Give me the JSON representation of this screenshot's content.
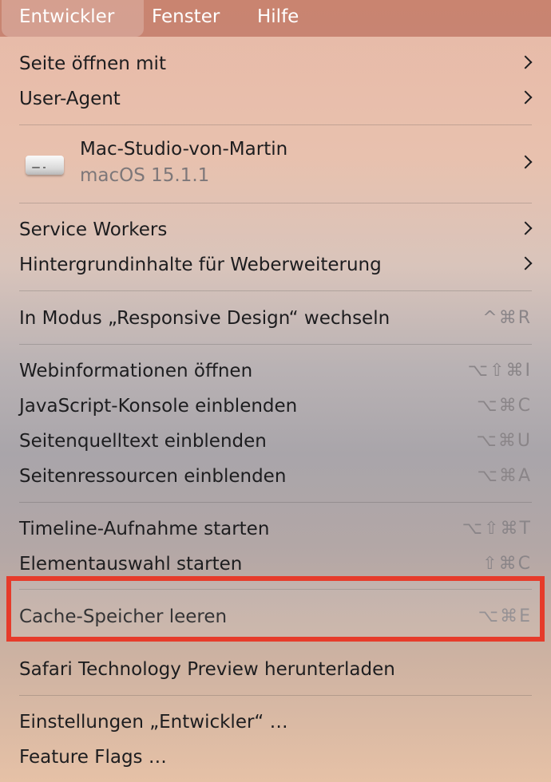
{
  "menubar": {
    "items": [
      {
        "label": "Entwickler",
        "active": true
      },
      {
        "label": "Fenster"
      },
      {
        "label": "Hilfe"
      }
    ]
  },
  "menu": {
    "open_with": "Seite öffnen mit",
    "user_agent": "User-Agent",
    "device": {
      "name": "Mac-Studio-von-Martin",
      "os": "macOS 15.1.1",
      "icon": "mac-studio-icon"
    },
    "service_workers": "Service Workers",
    "background_content": "Hintergrundinhalte für Weberweiterung",
    "responsive": {
      "label": "In Modus „Responsive Design“ wechseln",
      "shortcut": "^⌘R"
    },
    "web_inspector": {
      "label": "Webinformationen öffnen",
      "shortcut": "⌥⇧⌘I"
    },
    "js_console": {
      "label": "JavaScript-Konsole einblenden",
      "shortcut": "⌥⌘C"
    },
    "page_source": {
      "label": "Seitenquelltext einblenden",
      "shortcut": "⌥⌘U"
    },
    "page_resources": {
      "label": "Seitenressourcen einblenden",
      "shortcut": "⌥⌘A"
    },
    "timeline": {
      "label": "Timeline-Aufnahme starten",
      "shortcut": "⌥⇧⌘T"
    },
    "element_select": {
      "label": "Elementauswahl starten",
      "shortcut": "⇧⌘C"
    },
    "empty_cache": {
      "label": "Cache-Speicher leeren",
      "shortcut": "⌥⌘E"
    },
    "stp_download": "Safari Technology Preview herunterladen",
    "dev_settings": "Einstellungen „Entwickler“ …",
    "feature_flags": "Feature Flags …"
  },
  "colors": {
    "highlight_border": "#e63b2a",
    "menubar": "#c98470"
  }
}
